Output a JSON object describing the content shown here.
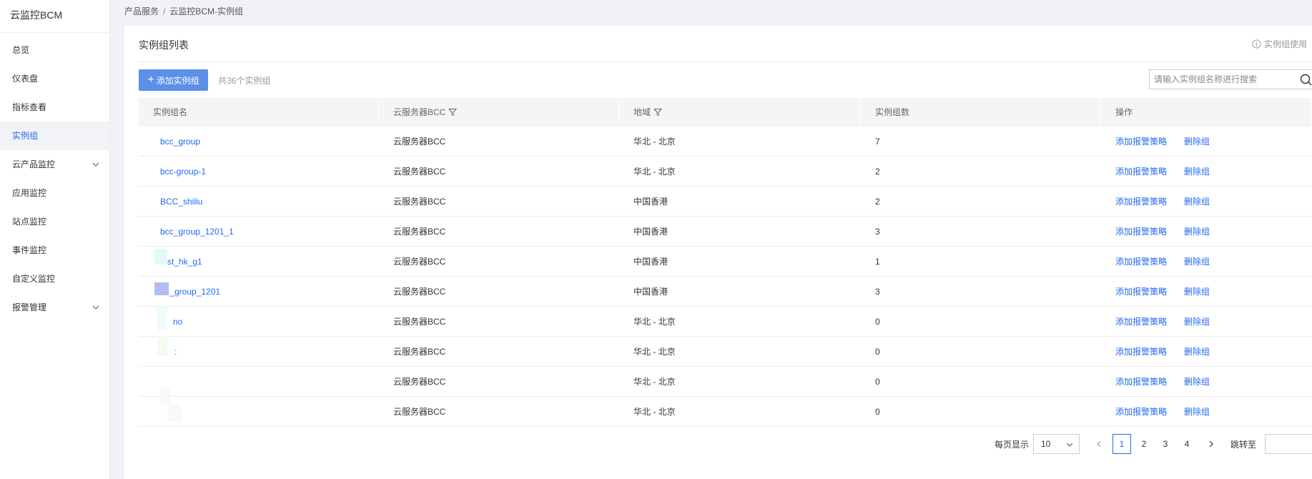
{
  "sidebar": {
    "brand": "云监控BCM",
    "items": [
      {
        "label": "总览"
      },
      {
        "label": "仪表盘"
      },
      {
        "label": "指标查看"
      },
      {
        "label": "实例组"
      },
      {
        "label": "云产品监控"
      },
      {
        "label": "应用监控"
      },
      {
        "label": "站点监控"
      },
      {
        "label": "事件监控"
      },
      {
        "label": "自定义监控"
      },
      {
        "label": "报警管理"
      }
    ],
    "active_item": "实例组"
  },
  "breadcrumb": {
    "parent": "产品服务",
    "separator": "/",
    "current": "云监控BCM-实例组"
  },
  "panel": {
    "title": "实例组列表",
    "hint": "实例组使用"
  },
  "toolbar": {
    "add_label": "添加实例组",
    "count_text": "共36个实例组",
    "search_placeholder": "请输入实例组名称进行搜索"
  },
  "table": {
    "headers": [
      "实例组名",
      "云服务器BCC",
      "地域",
      "实例组数",
      "操作"
    ],
    "rows": [
      {
        "name": "bcc_group",
        "service": "云服务器BCC",
        "region": "华北 - 北京",
        "count": "7"
      },
      {
        "name": "bcc-group-1",
        "service": "云服务器BCC",
        "region": "华北 - 北京",
        "count": "2"
      },
      {
        "name": "BCC_shiliu",
        "service": "云服务器BCC",
        "region": "中国香港",
        "count": "2"
      },
      {
        "name": "bcc_group_1201_1",
        "service": "云服务器BCC",
        "region": "中国香港",
        "count": "3"
      },
      {
        "name": "st_hk_g1",
        "service": "云服务器BCC",
        "region": "中国香港",
        "count": "1"
      },
      {
        "name": ":_group_1201",
        "service": "云服务器BCC",
        "region": "中国香港",
        "count": "3"
      },
      {
        "name": "no",
        "service": "云服务器BCC",
        "region": "华北 - 北京",
        "count": "0"
      },
      {
        "name": ":",
        "service": "云服务器BCC",
        "region": "华北 - 北京",
        "count": "0"
      },
      {
        "name": "",
        "service": "云服务器BCC",
        "region": "华北 - 北京",
        "count": "0"
      },
      {
        "name": "",
        "service": "云服务器BCC",
        "region": "华北 - 北京",
        "count": "0"
      }
    ],
    "op_add_alarm": "添加报警策略",
    "op_delete": "删除组"
  },
  "pagination": {
    "page_size_label": "每页显示",
    "page_size": "10",
    "pages": [
      "1",
      "2",
      "3",
      "4"
    ],
    "current_page": "1",
    "jump_label": "跳转至"
  },
  "colors": {
    "accent": "#2468f2",
    "button": "#5b8fe8",
    "background": "#f0f2f5"
  }
}
